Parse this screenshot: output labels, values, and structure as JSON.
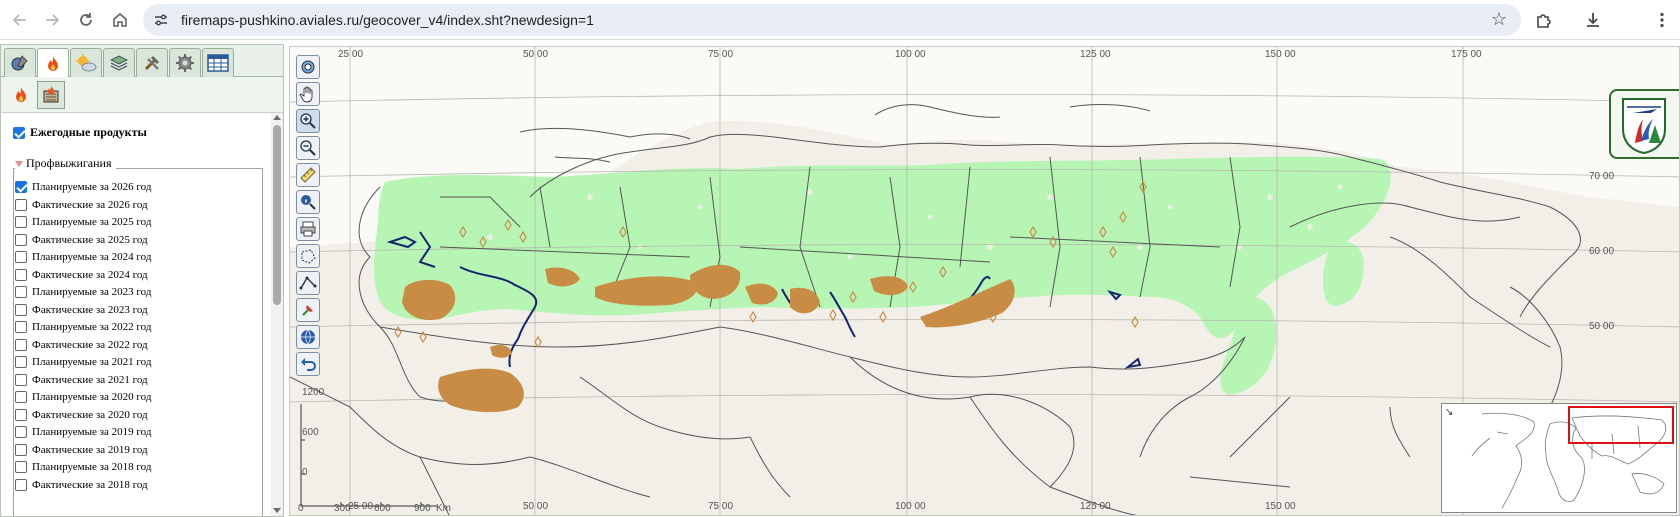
{
  "browser": {
    "url": "firemaps-pushkino.aviales.ru/geocover_v4/index.sht?newdesign=1"
  },
  "left_panel": {
    "annual_products_label": "Ежегодные продукты",
    "annual_products_checked": true,
    "group_label": "Профвыжигания",
    "items": [
      {
        "label": "Планируемые за 2026 год",
        "checked": true
      },
      {
        "label": "Фактические за 2026 год",
        "checked": false
      },
      {
        "label": "Планируемые за 2025 год",
        "checked": false
      },
      {
        "label": "Фактические за 2025 год",
        "checked": false
      },
      {
        "label": "Планируемые за 2024 год",
        "checked": false
      },
      {
        "label": "Фактические за 2024 год",
        "checked": false
      },
      {
        "label": "Планируемые за 2023 год",
        "checked": false
      },
      {
        "label": "Фактические за 2023 год",
        "checked": false
      },
      {
        "label": "Планируемые за 2022 год",
        "checked": false
      },
      {
        "label": "Фактические за 2022 год",
        "checked": false
      },
      {
        "label": "Планируемые за 2021 год",
        "checked": false
      },
      {
        "label": "Фактические за 2021 год",
        "checked": false
      },
      {
        "label": "Планируемые за 2020 год",
        "checked": false
      },
      {
        "label": "Фактические за 2020 год",
        "checked": false
      },
      {
        "label": "Планируемые за 2019 год",
        "checked": false
      },
      {
        "label": "Фактические за 2019 год",
        "checked": false
      },
      {
        "label": "Планируемые за 2018 год",
        "checked": false
      },
      {
        "label": "Фактические за 2018 год",
        "checked": false
      }
    ]
  },
  "map": {
    "lon_labels_top": [
      "25 00",
      "50 00",
      "75 00",
      "100 00",
      "125 00",
      "150 00",
      "175 00"
    ],
    "lon_labels_bottom": [
      "25 00",
      "50 00",
      "75 00",
      "100 00",
      "125 00",
      "150 00"
    ],
    "lat_labels": [
      "70 00",
      "60 00",
      "50 00"
    ],
    "scale_left": [
      "1200",
      "600",
      "0"
    ],
    "scale_bottom": [
      "0",
      "300",
      "600",
      "900",
      "Km"
    ],
    "colors": {
      "background": "#f2efe9",
      "forest": "#b7f5b4",
      "burns": "#c98c45",
      "hydro": "#14246e",
      "border": "#555555"
    }
  }
}
